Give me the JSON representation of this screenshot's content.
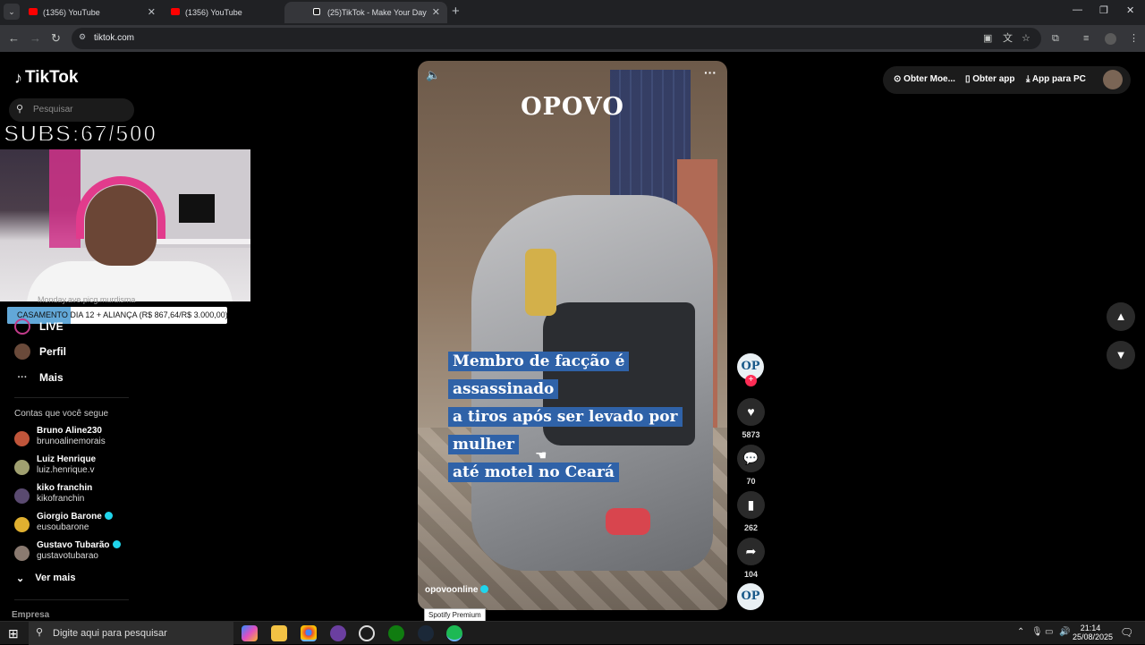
{
  "browser": {
    "tabs": [
      {
        "title": "(1356) YouTube",
        "color": "#ff0000"
      },
      {
        "title": "(1356) YouTube",
        "color": "#ff0000"
      },
      {
        "title": "(25)TikTok - Make Your Day",
        "color": "#ffffff"
      }
    ],
    "url": "tiktok.com"
  },
  "tiktok": {
    "logo": "TikTok",
    "search_placeholder": "Pesquisar",
    "nav": [
      {
        "label": "LIVE",
        "icon": "live-icon"
      },
      {
        "label": "Perfil",
        "icon": "profile-avatar"
      },
      {
        "label": "Mais",
        "icon": "more-dots-icon"
      }
    ],
    "following_title": "Contas que você segue",
    "following": [
      {
        "name": "Bruno Aline230",
        "handle": "brunoalinemorais",
        "verified": false,
        "color": "#c0553a"
      },
      {
        "name": "Luiz Henrique",
        "handle": "luiz.henrique.v",
        "verified": false,
        "color": "#a0a070"
      },
      {
        "name": "kiko franchin",
        "handle": "kikofranchin",
        "verified": false,
        "color": "#5a4a70"
      },
      {
        "name": "Giorgio Barone",
        "handle": "eusoubarone",
        "verified": true,
        "color": "#e0b030"
      },
      {
        "name": "Gustavo Tubarão",
        "handle": "gustavotubarao",
        "verified": true,
        "color": "#8a7a70"
      }
    ],
    "see_more": "Ver mais",
    "company": "Empresa",
    "header_actions": [
      "Obter Moe...",
      "Obter app",
      "App para PC"
    ]
  },
  "overlay": {
    "subs": "SUBS:67/500",
    "goal_text": "CASAMENTO DIA 12 + ALIANÇA (R$ 867,64/R$ 3.000,00)",
    "goal_progress": 0.289,
    "under_text": "Monday.ave.picg.murdisma"
  },
  "video": {
    "brand": "OPOVO",
    "headline_lines": [
      "Membro de facção é assassinado",
      "a tiros após ser levado por mulher",
      "até motel no Ceará"
    ],
    "author": "opovoonline",
    "avatar_text": "OP",
    "likes": "5873",
    "comments": "70",
    "saves": "262",
    "shares": "104",
    "tooltip": "Spotify Premium"
  },
  "taskbar": {
    "search_placeholder": "Digite aqui para pesquisar",
    "time": "21:14",
    "date": "25/08/2025"
  },
  "colors": {
    "accent": "#fe2c55",
    "verified": "#20d5ec",
    "headline_bg": "#2f62a8"
  }
}
